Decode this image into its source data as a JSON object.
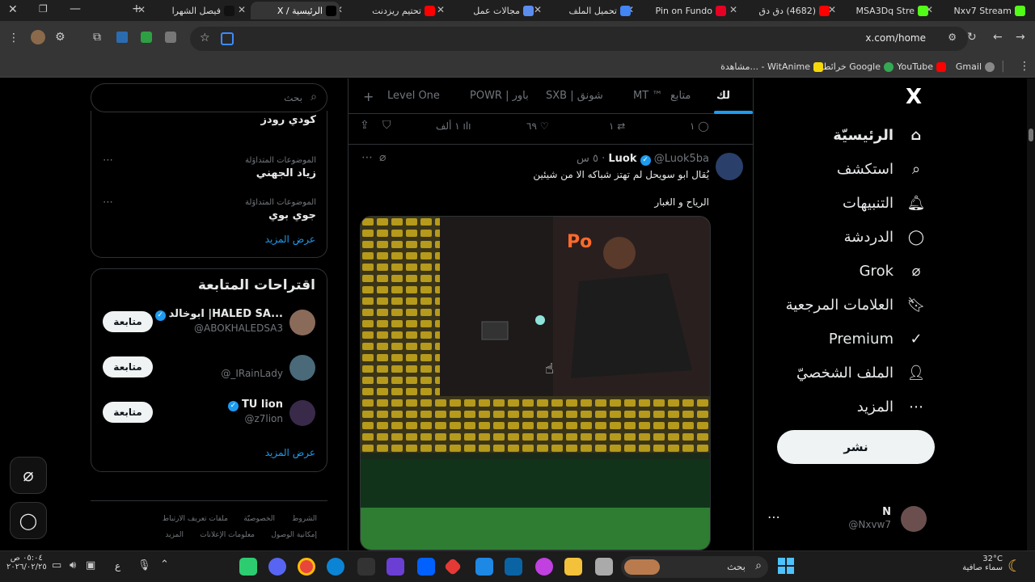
{
  "browser": {
    "tabs": [
      {
        "title": "Nxv7 Stream",
        "fav": "#53fc18"
      },
      {
        "title": "MSA3Dq Stre",
        "fav": "#53fc18"
      },
      {
        "title": "(4682) دق دق",
        "fav": "#ff0000"
      },
      {
        "title": "Pin on Fundo",
        "fav": "#e60023"
      },
      {
        "title": "تحميل الملف",
        "fav": "#4285f4"
      },
      {
        "title": "مجالات عمل",
        "fav": "#5b8def"
      },
      {
        "title": "تحتيم ريزدنت",
        "fav": "#ff0000"
      },
      {
        "title": "الرئيسية / X",
        "fav": "#000000"
      },
      {
        "title": "فيصل الشهرا",
        "fav": "#111111"
      }
    ],
    "url": "x.com/home",
    "bookmarks": [
      "Gmail",
      "YouTube",
      "خرائط Google",
      "مشاهدة... - WitAnime"
    ]
  },
  "nav": {
    "logo": "X",
    "items": [
      {
        "label": "الرئيسيّة",
        "icon": "home-icon",
        "glyph": "⌂"
      },
      {
        "label": "استكشف",
        "icon": "search-icon",
        "glyph": "⌕"
      },
      {
        "label": "التنبيهات",
        "icon": "bell-icon",
        "glyph": "🔔︎"
      },
      {
        "label": "الدردشة",
        "icon": "chat-icon",
        "glyph": "◯"
      },
      {
        "label": "Grok",
        "icon": "grok-icon",
        "glyph": "⌀"
      },
      {
        "label": "العلامات المرجعية",
        "icon": "bookmark-icon",
        "glyph": "🔖︎"
      },
      {
        "label": "Premium",
        "icon": "premium-icon",
        "glyph": "✓"
      },
      {
        "label": "الملف الشخصيّ",
        "icon": "profile-icon",
        "glyph": "👤︎"
      },
      {
        "label": "المزيد",
        "icon": "more-icon",
        "glyph": "⋯"
      }
    ],
    "post_label": "نشر",
    "account": {
      "name": "N",
      "handle": "@Nxvw7"
    }
  },
  "feed": {
    "tabs": [
      "لك",
      "متابع",
      "MT ™",
      "SXB | شونق",
      "POWR | باور",
      "Level One"
    ],
    "top_actions": {
      "reply": "١",
      "repost": "١",
      "like": "٦٩",
      "views": "١ ألف"
    },
    "tweet": {
      "name": "Luok",
      "handle": "@Luok5ba",
      "time": "٥ س",
      "text1": "يُقال ابو سويحل لم تهتز شباكه الا من شيئين",
      "text2": "الرياح و الغبار"
    }
  },
  "right": {
    "search_placeholder": "بحث",
    "trends": [
      {
        "category": "",
        "name": "كودي رودز"
      },
      {
        "category": "الموضوعات المتداوَلة",
        "name": "زياد الجهني"
      },
      {
        "category": "الموضوعات المتداوَلة",
        "name": "جوي بوي"
      }
    ],
    "show_more": "عرض المزيد",
    "who_to_follow_title": "اقتراحات المتابعة",
    "suggestions": [
      {
        "name": "ابوخالد |HALED SA...",
        "handle": "@ABOKHALEDSA3",
        "verified": true
      },
      {
        "name": "",
        "handle": "@_IRainLady",
        "verified": false
      },
      {
        "name": "TU lion",
        "handle": "@z7lion",
        "verified": true
      }
    ],
    "follow_label": "متابعة",
    "footer": [
      "الشروط",
      "الخصوصيّة",
      "ملفات تعريف الارتباط",
      "إمكانية الوصول",
      "معلومات الإعلانات",
      "المزيد"
    ]
  },
  "taskbar": {
    "weather_temp": "32°C",
    "weather_desc": "سماء صافية",
    "search": "بحث",
    "time": "٠٥:٠٤ ص",
    "date": "٢٠٢٦/٠٢/٢٥",
    "lang": "ع"
  }
}
